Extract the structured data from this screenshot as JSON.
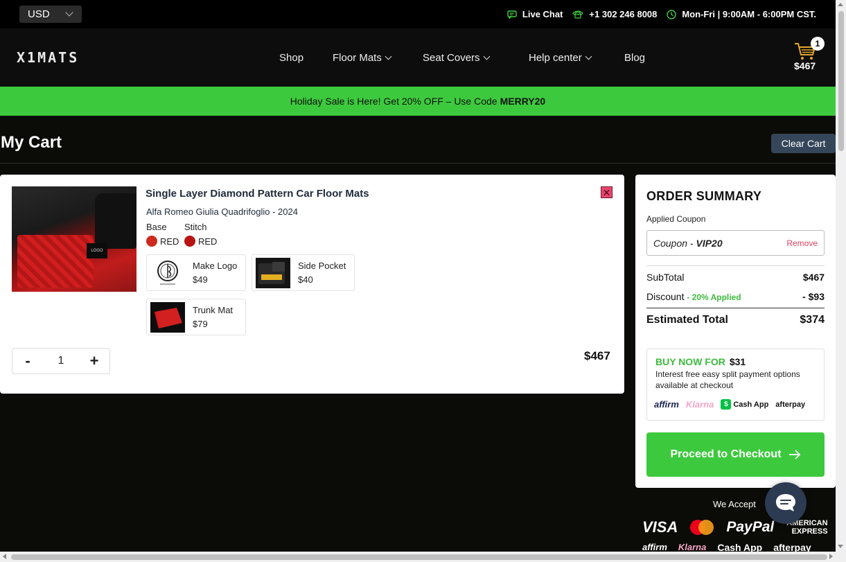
{
  "topbar": {
    "currency": "USD",
    "live_chat": "Live Chat",
    "phone": "+1 302 246 8008",
    "hours": "Mon-Fri | 9:00AM - 6:00PM CST."
  },
  "header": {
    "logo": "X1MATS",
    "nav": [
      "Shop",
      "Floor Mats",
      "Seat Covers",
      "Help center",
      "Blog"
    ],
    "cart_count": "1",
    "cart_total": "$467"
  },
  "promo": {
    "text": "Holiday Sale is Here! Get 20% OFF – Use Code",
    "code": "MERRY20"
  },
  "page": {
    "title": "My Cart",
    "clear_cart": "Clear Cart"
  },
  "item": {
    "title": "Single Layer Diamond Pattern Car Floor Mats",
    "vehicle": "Alfa Romeo Giulia Quadrifoglio - 2024",
    "base_label": "Base",
    "stitch_label": "Stitch",
    "base_color": "RED",
    "stitch_color": "RED",
    "base_hex": "#cc2a1e",
    "stitch_hex": "#b81414",
    "image_tag": "LOGO",
    "addons": [
      {
        "name": "Make Logo",
        "price": "$49"
      },
      {
        "name": "Side Pocket",
        "price": "$40"
      },
      {
        "name": "Trunk Mat",
        "price": "$79"
      }
    ],
    "quantity": "1",
    "minus": "-",
    "plus": "+",
    "line_total": "$467"
  },
  "summary": {
    "title": "ORDER SUMMARY",
    "applied_coupon_label": "Applied Coupon",
    "coupon_prefix": "Coupon - ",
    "coupon_code": "VIP20",
    "remove": "Remove",
    "subtotal_label": "SubTotal",
    "subtotal": "$467",
    "discount_label": "Discount",
    "discount_tag": "- 20% Applied",
    "discount": "- $93",
    "estimated_label": "Estimated Total",
    "estimated": "$374",
    "bnpl_heading": "BUY NOW FOR",
    "bnpl_amount": "$31",
    "bnpl_desc": "Interest free easy split payment options available at checkout",
    "bnpl_logos": [
      "affirm",
      "Klarna",
      "Cash App",
      "afterpay"
    ],
    "checkout": "Proceed to Checkout"
  },
  "footer": {
    "we_accept": "We Accept",
    "cards": [
      "VISA",
      "PayPal",
      "AMERICAN",
      "EXPRESS"
    ],
    "row2": [
      "affirm",
      "Klarna",
      "Cash App",
      "afterpay"
    ]
  },
  "colors": {
    "accent_green": "#3dc93d",
    "remove_red": "#e2425e",
    "clear_btn": "#36465a"
  }
}
